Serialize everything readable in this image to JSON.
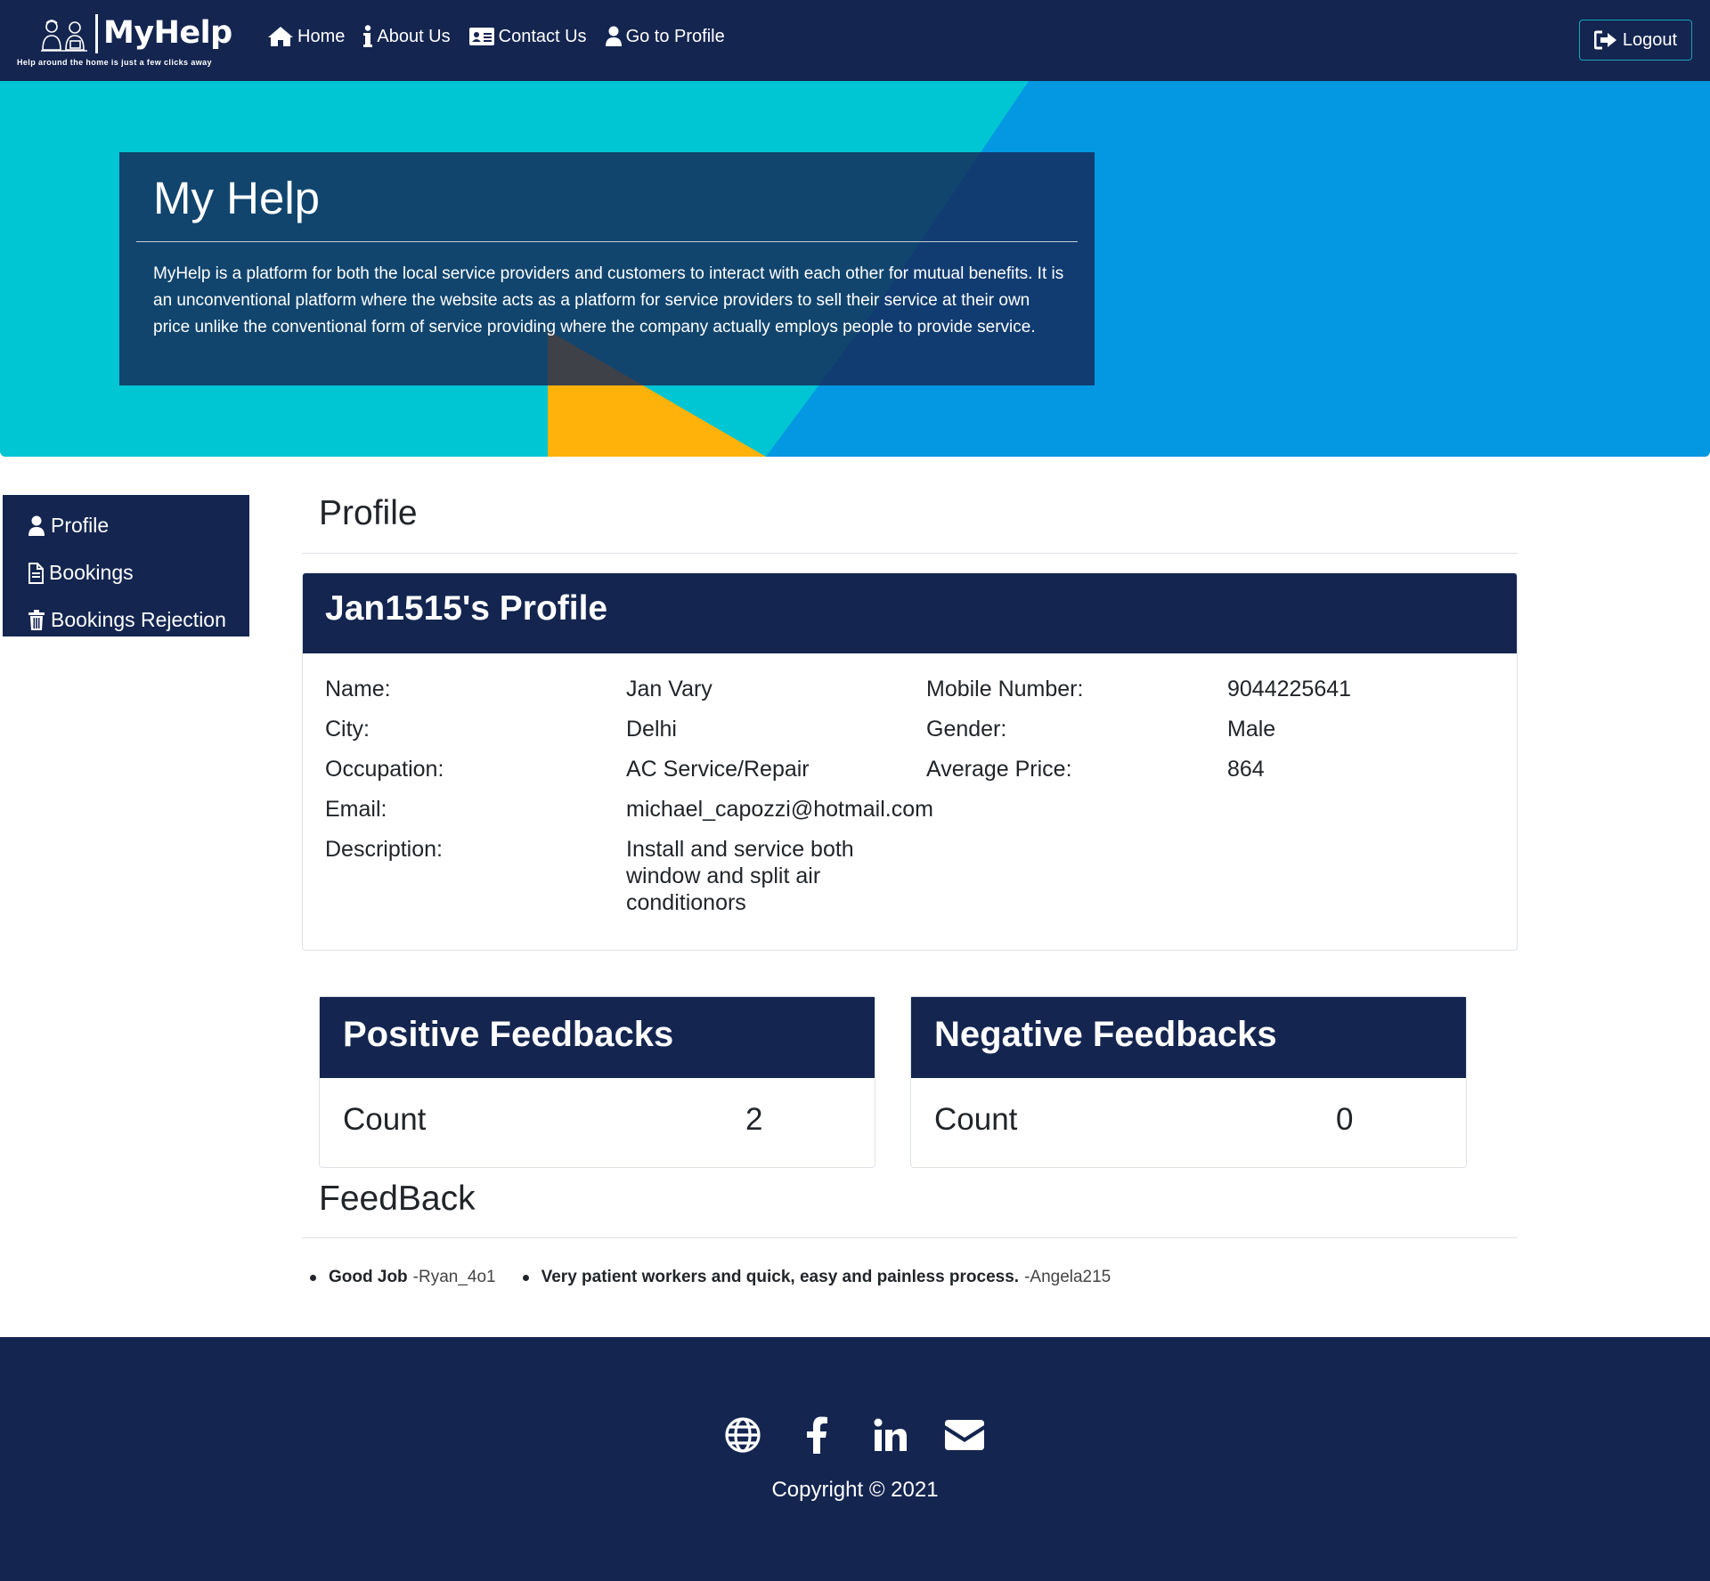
{
  "navbar": {
    "brand_name": "MyHelp",
    "brand_tagline": "Help around the home is just a few clicks away",
    "links": [
      {
        "label": "Home",
        "icon": "home-icon"
      },
      {
        "label": "About Us",
        "icon": "info-icon"
      },
      {
        "label": "Contact Us",
        "icon": "id-card-icon"
      },
      {
        "label": "Go to Profile",
        "icon": "user-icon"
      }
    ],
    "logout_label": "Logout"
  },
  "hero": {
    "title": "My Help",
    "text": "MyHelp is a platform for both the local service providers and customers to interact with each other for mutual benefits. It is an unconventional platform where the website acts as a platform for service providers to sell their service at their own price unlike the conventional form of service providing where the company actually employs people to provide service."
  },
  "sidebar": {
    "items": [
      {
        "label": "Profile",
        "icon": "user-icon"
      },
      {
        "label": "Bookings",
        "icon": "document-icon"
      },
      {
        "label": "Bookings Rejection",
        "icon": "trash-icon"
      }
    ]
  },
  "main": {
    "section_title": "Profile",
    "profile": {
      "heading": "Jan1515's Profile",
      "name_label": "Name:",
      "name": "Jan Vary",
      "mobile_label": "Mobile Number:",
      "mobile": "9044225641",
      "city_label": "City:",
      "city": "Delhi",
      "gender_label": "Gender:",
      "gender": "Male",
      "occupation_label": "Occupation:",
      "occupation": "AC Service/Repair",
      "avg_price_label": "Average Price:",
      "avg_price": "864",
      "email_label": "Email:",
      "email": "michael_capozzi@hotmail.com",
      "description_label": "Description:",
      "description": "Install and service both window and split air conditionors"
    },
    "positive": {
      "title": "Positive Feedbacks",
      "count_label": "Count",
      "count": "2"
    },
    "negative": {
      "title": "Negative Feedbacks",
      "count_label": "Count",
      "count": "0"
    },
    "feedback_title": "FeedBack",
    "feedbacks": [
      {
        "text": "Good Job",
        "author": "-Ryan_4o1"
      },
      {
        "text": "Very patient workers and quick, easy and painless process.",
        "author": "-Angela215"
      }
    ]
  },
  "footer": {
    "social": [
      "globe-icon",
      "facebook-icon",
      "linkedin-icon",
      "envelope-icon"
    ],
    "copyright": "Copyright © 2021"
  },
  "colors": {
    "navy": "#142550",
    "hero_cyan": "#00c5d2",
    "hero_blue": "#0497e2",
    "hero_yellow": "#ffb20a",
    "outline_accent": "#17a2b8"
  }
}
